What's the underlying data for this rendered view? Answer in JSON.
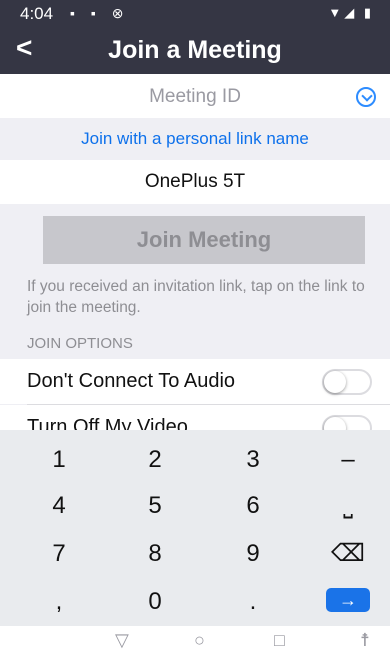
{
  "status": {
    "time": "4:04",
    "left_icons": "▪ ▪ ⊗",
    "right_icons": "▼◢ ▮"
  },
  "header": {
    "back": "<",
    "title": "Join a Meeting"
  },
  "form": {
    "meeting_id_placeholder": "Meeting ID",
    "personal_link": "Join with a personal link name",
    "name_value": "OnePlus 5T",
    "join_button": "Join Meeting",
    "hint": "If you received an invitation link, tap on the link to join the meeting."
  },
  "options": {
    "header": "JOIN OPTIONS",
    "items": [
      {
        "label": "Don't Connect To Audio",
        "on": false
      },
      {
        "label": "Turn Off My Video",
        "on": false
      }
    ]
  },
  "keypad": {
    "keys": [
      {
        "label": "1"
      },
      {
        "label": "2"
      },
      {
        "label": "3"
      },
      {
        "label": "–"
      },
      {
        "label": "4"
      },
      {
        "label": "5"
      },
      {
        "label": "6"
      },
      {
        "label": "⎵"
      },
      {
        "label": "7"
      },
      {
        "label": "8"
      },
      {
        "label": "9"
      },
      {
        "label": "⌫"
      },
      {
        "label": ","
      },
      {
        "label": "0"
      },
      {
        "label": "."
      },
      {
        "label": "→"
      }
    ],
    "enter_color": "#1a73e8"
  },
  "navbar": {
    "back": "▽",
    "home": "○",
    "recent": "□",
    "accessibility": "☨"
  }
}
